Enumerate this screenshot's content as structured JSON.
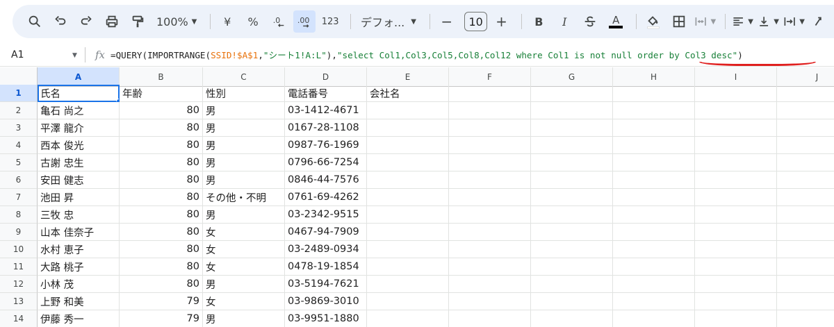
{
  "toolbar": {
    "zoom": "100%",
    "currency": "¥",
    "percent": "%",
    "decimal_decrease": ".0",
    "decimal_increase": ".00",
    "number_format": "123",
    "font_family": "デフォ...",
    "font_size": "10",
    "minus": "−",
    "plus": "+",
    "bold": "B",
    "italic": "I",
    "text_color_letter": "A"
  },
  "formula_bar": {
    "cell_ref": "A1",
    "fx": "fx",
    "formula_parts": {
      "p1": "=QUERY(IMPORTRANGE(",
      "p2": "SSID!$A$1",
      "p3": ",",
      "p4": "\"シート1!A:L\"",
      "p5": "),",
      "p6": "\"select Col1,Col3,Col5,Col8,Col12 where Col1 is not null order by Col3 desc\"",
      "p7": ")"
    }
  },
  "grid": {
    "columns": [
      "A",
      "B",
      "C",
      "D",
      "E",
      "F",
      "G",
      "H",
      "I",
      "J"
    ],
    "rows": [
      {
        "num": "1",
        "a": "氏名",
        "b": "年齢",
        "c": "性別",
        "d": "電話番号",
        "e": "会社名"
      },
      {
        "num": "2",
        "a": "亀石 尚之",
        "b": "80",
        "c": "男",
        "d": "03-1412-4671",
        "e": ""
      },
      {
        "num": "3",
        "a": "平澤 龍介",
        "b": "80",
        "c": "男",
        "d": "0167-28-1108",
        "e": ""
      },
      {
        "num": "4",
        "a": "西本 俊光",
        "b": "80",
        "c": "男",
        "d": "0987-76-1969",
        "e": ""
      },
      {
        "num": "5",
        "a": "古謝 忠生",
        "b": "80",
        "c": "男",
        "d": "0796-66-7254",
        "e": ""
      },
      {
        "num": "6",
        "a": "安田 健志",
        "b": "80",
        "c": "男",
        "d": "0846-44-7576",
        "e": ""
      },
      {
        "num": "7",
        "a": "池田 昇",
        "b": "80",
        "c": "その他・不明",
        "d": "0761-69-4262",
        "e": ""
      },
      {
        "num": "8",
        "a": "三牧 忠",
        "b": "80",
        "c": "男",
        "d": "03-2342-9515",
        "e": ""
      },
      {
        "num": "9",
        "a": "山本 佳奈子",
        "b": "80",
        "c": "女",
        "d": "0467-94-7909",
        "e": ""
      },
      {
        "num": "10",
        "a": "水村 恵子",
        "b": "80",
        "c": "女",
        "d": "03-2489-0934",
        "e": ""
      },
      {
        "num": "11",
        "a": "大路 桃子",
        "b": "80",
        "c": "女",
        "d": "0478-19-1854",
        "e": ""
      },
      {
        "num": "12",
        "a": "小林 茂",
        "b": "80",
        "c": "男",
        "d": "03-5194-7621",
        "e": ""
      },
      {
        "num": "13",
        "a": "上野 和美",
        "b": "79",
        "c": "女",
        "d": "03-9869-3010",
        "e": ""
      },
      {
        "num": "14",
        "a": "伊藤 秀一",
        "b": "79",
        "c": "男",
        "d": "03-9951-1880",
        "e": ""
      }
    ]
  },
  "colors": {
    "toolbar_bg": "#edf2fa",
    "selection": "#1a73e8",
    "header_selected": "#d3e3fd",
    "formula_range": "#e8710a",
    "formula_string": "#188038",
    "annotation": "#e0201f"
  }
}
